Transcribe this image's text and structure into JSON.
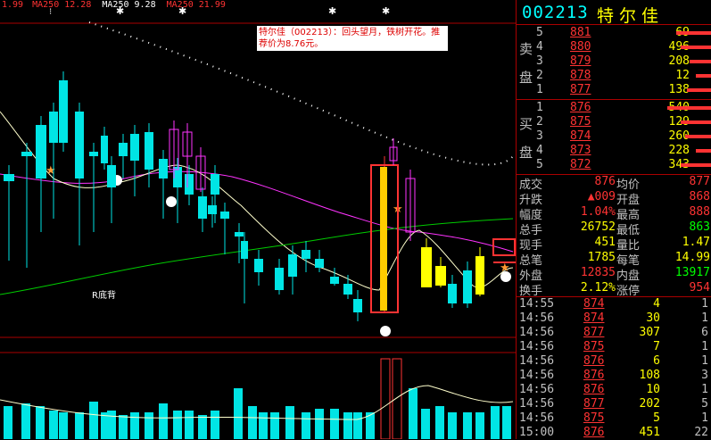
{
  "ma_header": [
    {
      "text": "1.99",
      "color": "#ff3333"
    },
    {
      "text": "MA250 12.28",
      "color": "#ff3333"
    },
    {
      "text": "MA250 9.28",
      "color": "#ffffff"
    },
    {
      "text": "MA250 21.99",
      "color": "#ff3333"
    }
  ],
  "annotation": "特尔佳（002213）：回头望月，铁树开花。推荐价为8.76元。",
  "chart_label": "R底背",
  "stock": {
    "code": "002213",
    "name": "特尔佳"
  },
  "sell_label": [
    "卖",
    "盘"
  ],
  "buy_label": [
    "买",
    "盘"
  ],
  "sell": [
    {
      "idx": "5",
      "price": "881",
      "vol": "69"
    },
    {
      "idx": "4",
      "price": "880",
      "vol": "496"
    },
    {
      "idx": "3",
      "price": "879",
      "vol": "208"
    },
    {
      "idx": "2",
      "price": "878",
      "vol": "12"
    },
    {
      "idx": "1",
      "price": "877",
      "vol": "138"
    }
  ],
  "buy": [
    {
      "idx": "1",
      "price": "876",
      "vol": "540"
    },
    {
      "idx": "2",
      "price": "875",
      "vol": "129"
    },
    {
      "idx": "3",
      "price": "874",
      "vol": "260"
    },
    {
      "idx": "4",
      "price": "873",
      "vol": "228"
    },
    {
      "idx": "5",
      "price": "872",
      "vol": "343"
    }
  ],
  "quote": [
    {
      "l": "成交",
      "v": "876",
      "vc": "red",
      "l2": "均价",
      "v2": "877",
      "v2c": "red"
    },
    {
      "l": "升跌",
      "v": "▲009",
      "vc": "red",
      "l2": "开盘",
      "v2": "868",
      "v2c": "red"
    },
    {
      "l": "幅度",
      "v": "1.04%",
      "vc": "red",
      "l2": "最高",
      "v2": "888",
      "v2c": "red"
    },
    {
      "l": "总手",
      "v": "26752",
      "vc": "yel",
      "l2": "最低",
      "v2": "863",
      "v2c": "grn"
    },
    {
      "l": "现手",
      "v": "451",
      "vc": "yel",
      "l2": "量比",
      "v2": "1.47",
      "v2c": "yel"
    },
    {
      "l": "总笔",
      "v": "1785",
      "vc": "yel",
      "l2": "每笔",
      "v2": "14.99",
      "v2c": "yel"
    },
    {
      "l": "外盘",
      "v": "12835",
      "vc": "red",
      "l2": "内盘",
      "v2": "13917",
      "v2c": "grn"
    },
    {
      "l": "换手",
      "v": "2.12%",
      "vc": "yel",
      "l2": "涨停",
      "v2": "954",
      "v2c": "red"
    }
  ],
  "ticks": [
    {
      "t": "14:55",
      "p": "874",
      "v": "4",
      "n": "1"
    },
    {
      "t": "14:56",
      "p": "874",
      "v": "30",
      "n": "1"
    },
    {
      "t": "14:56",
      "p": "877",
      "v": "307",
      "n": "6"
    },
    {
      "t": "14:56",
      "p": "875",
      "v": "7",
      "n": "1"
    },
    {
      "t": "14:56",
      "p": "876",
      "v": "6",
      "n": "1"
    },
    {
      "t": "14:56",
      "p": "876",
      "v": "108",
      "n": "3"
    },
    {
      "t": "14:56",
      "p": "876",
      "v": "10",
      "n": "1"
    },
    {
      "t": "14:56",
      "p": "877",
      "v": "202",
      "n": "5"
    },
    {
      "t": "14:56",
      "p": "875",
      "v": "5",
      "n": "1"
    },
    {
      "t": "15:00",
      "p": "876",
      "v": "451",
      "n": "22"
    }
  ],
  "chart_data": {
    "type": "candlestick",
    "candles": [
      {
        "o": 40,
        "c": 195,
        "h": 190,
        "l": 292,
        "color": "cyan"
      },
      {
        "o": 20,
        "c": 170,
        "h": 175,
        "l": 300,
        "color": "cyan"
      },
      {
        "o": 40,
        "c": 140,
        "h": 200,
        "l": 260,
        "color": "cyan"
      },
      {
        "o": 40,
        "c": 125,
        "h": 160,
        "l": 245,
        "color": "cyan"
      },
      {
        "o": 60,
        "c": 90,
        "h": 160,
        "l": 170,
        "color": "cyan"
      },
      {
        "o": 65,
        "c": 125,
        "h": 200,
        "l": 275,
        "color": "cyan"
      },
      {
        "o": 40,
        "c": 170,
        "h": 175,
        "l": 260,
        "color": "cyan"
      },
      {
        "o": 20,
        "c": 152,
        "h": 183,
        "l": 190,
        "color": "cyan"
      },
      {
        "o": 30,
        "c": 185,
        "h": 210,
        "l": 250,
        "color": "cyan"
      },
      {
        "o": 20,
        "c": 160,
        "h": 175,
        "l": 200,
        "color": "cyan"
      },
      {
        "o": 20,
        "c": 150,
        "h": 180,
        "l": 220,
        "color": "cyan"
      },
      {
        "o": 20,
        "c": 148,
        "h": 190,
        "l": 210,
        "color": "cyan"
      },
      {
        "o": 30,
        "c": 178,
        "h": 200,
        "l": 245,
        "color": "cyan"
      },
      {
        "o": 30,
        "c": 187,
        "h": 210,
        "l": 250,
        "color": "cyan"
      },
      {
        "o": 20,
        "c": 195,
        "h": 218,
        "l": 230,
        "color": "cyan"
      },
      {
        "o": 20,
        "c": 220,
        "h": 245,
        "l": 260,
        "color": "cyan"
      },
      {
        "o": 20,
        "c": 195,
        "h": 218,
        "l": 250,
        "color": "cyan"
      },
      {
        "o": 20,
        "c": 145,
        "h": 190,
        "l": 200,
        "color": "magenta-hollow"
      },
      {
        "o": 20,
        "c": 148,
        "h": 175,
        "l": 210,
        "color": "magenta-hollow"
      },
      {
        "o": 20,
        "c": 175,
        "h": 212,
        "l": 215,
        "color": "magenta-hollow"
      },
      {
        "o": 30,
        "c": 230,
        "h": 240,
        "l": 255,
        "color": "cyan"
      },
      {
        "o": 30,
        "c": 237,
        "h": 245,
        "l": 285,
        "color": "cyan"
      },
      {
        "o": 40,
        "c": 260,
        "h": 265,
        "l": 295,
        "color": "cyan"
      },
      {
        "o": 40,
        "c": 270,
        "h": 290,
        "l": 340,
        "color": "cyan"
      },
      {
        "o": 40,
        "c": 290,
        "h": 305,
        "l": 320,
        "color": "cyan"
      },
      {
        "o": 40,
        "c": 300,
        "h": 325,
        "l": 330,
        "color": "cyan"
      },
      {
        "o": 40,
        "c": 285,
        "h": 310,
        "l": 330,
        "color": "cyan"
      },
      {
        "o": 40,
        "c": 280,
        "h": 290,
        "l": 305,
        "color": "cyan"
      },
      {
        "o": 40,
        "c": 290,
        "h": 300,
        "l": 305,
        "color": "cyan"
      },
      {
        "o": 40,
        "c": 310,
        "h": 318,
        "l": 320,
        "color": "cyan"
      },
      {
        "o": 40,
        "c": 318,
        "h": 330,
        "l": 335,
        "color": "cyan"
      },
      {
        "o": 40,
        "c": 335,
        "h": 350,
        "l": 360,
        "color": "cyan"
      },
      {
        "o": 40,
        "c": 185,
        "h": 350,
        "l": 350,
        "color": "orange-box"
      },
      {
        "o": 40,
        "c": 165,
        "h": 180,
        "l": 185,
        "color": "magenta-hollow"
      },
      {
        "o": 40,
        "c": 200,
        "h": 260,
        "l": 270,
        "color": "magenta-hollow"
      },
      {
        "o": 40,
        "c": 277,
        "h": 322,
        "l": 322,
        "color": "yellow"
      },
      {
        "o": 40,
        "c": 298,
        "h": 320,
        "l": 322,
        "color": "yellow"
      },
      {
        "o": 40,
        "c": 318,
        "h": 340,
        "l": 345,
        "color": "cyan"
      },
      {
        "o": 40,
        "c": 303,
        "h": 340,
        "l": 345,
        "color": "cyan"
      },
      {
        "o": 40,
        "c": 287,
        "h": 330,
        "l": 332,
        "color": "yellow"
      }
    ]
  }
}
